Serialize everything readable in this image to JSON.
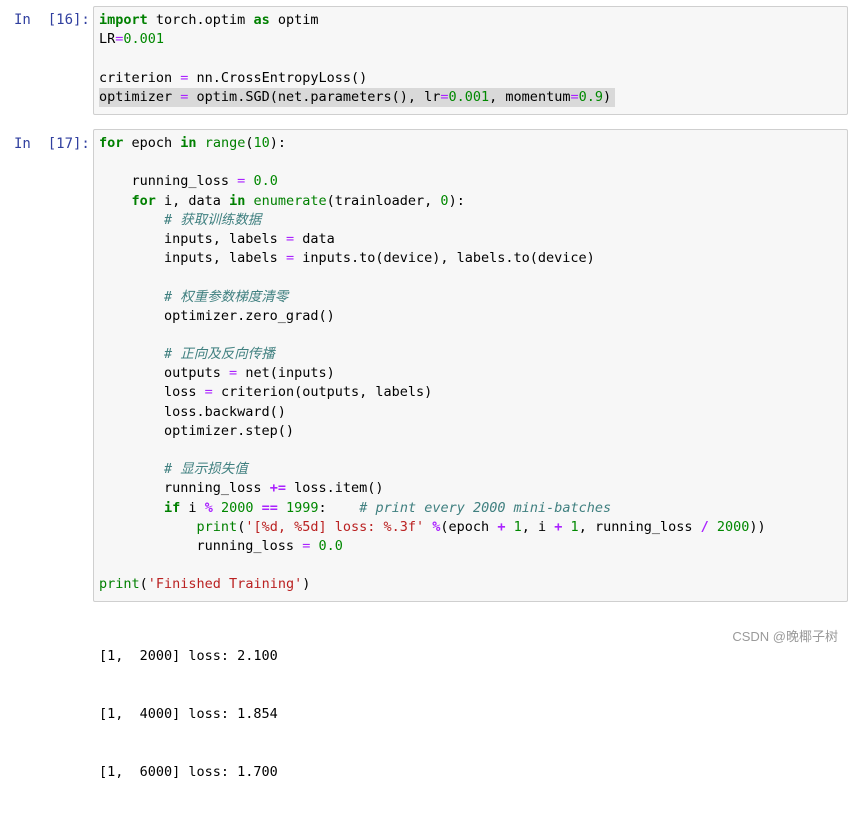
{
  "cells": [
    {
      "prompt": "In  [16]:",
      "lines": [
        "import torch.optim as optim",
        "LR=0.001",
        "",
        "criterion = nn.CrossEntropyLoss()",
        "optimizer = optim.SGD(net.parameters(), lr=0.001, momentum=0.9)"
      ]
    },
    {
      "prompt": "In  [17]:",
      "lines": [
        "for epoch in range(10):",
        "",
        "    running_loss = 0.0",
        "    for i, data in enumerate(trainloader, 0):",
        "        # 获取训练数据",
        "        inputs, labels = data",
        "        inputs, labels = inputs.to(device), labels.to(device)",
        "",
        "        # 权重参数梯度清零",
        "        optimizer.zero_grad()",
        "",
        "        # 正向及反向传播",
        "        outputs = net(inputs)",
        "        loss = criterion(outputs, labels)",
        "        loss.backward()",
        "        optimizer.step()",
        "",
        "        # 显示损失值",
        "        running_loss += loss.item()",
        "        if i % 2000 == 1999:    # print every 2000 mini-batches",
        "            print('[%d, %5d] loss: %.3f' %(epoch + 1, i + 1, running_loss / 2000))",
        "            running_loss = 0.0",
        "",
        "print('Finished Training')"
      ],
      "output": [
        "[1,  2000] loss: 2.100",
        "[1,  4000] loss: 1.854",
        "[1,  6000] loss: 1.700"
      ]
    }
  ],
  "watermark": "CSDN @晚椰子树"
}
